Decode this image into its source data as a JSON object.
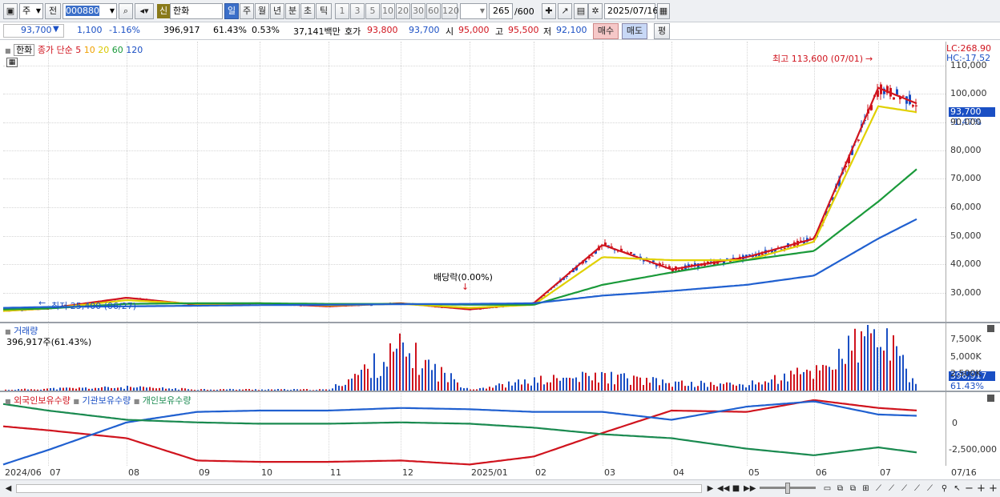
{
  "toolbar": {
    "type_select": "주",
    "prev_label": "전",
    "code": "000880",
    "badge": "신",
    "name": "한화",
    "periods": [
      "일",
      "주",
      "월",
      "년",
      "분",
      "초",
      "틱"
    ],
    "active_period": "일",
    "intervals": [
      "1",
      "3",
      "5",
      "10",
      "20",
      "30",
      "60",
      "120"
    ],
    "count_value": "265",
    "count_max": "/600",
    "date": "2025/07/16"
  },
  "quote": {
    "price": "93,700",
    "arrow": "▼",
    "change": "1,100",
    "change_pct": "-1.16%",
    "volume": "396,917",
    "vol_ratio": "61.43%",
    "turnover": "0.53%",
    "amount": "37,141백만",
    "hoga_label": "호가",
    "ask": "93,800",
    "bid": "93,700",
    "open_label": "시",
    "open": "95,000",
    "high_label": "고",
    "high": "95,500",
    "low_label": "저",
    "low": "92,100",
    "buy_label": "매수",
    "sell_label": "매도",
    "eval_label": "평"
  },
  "chart_legend": {
    "stock": "한화",
    "ma_title": "종가 단순",
    "ma_periods": [
      "5",
      "10",
      "20",
      "60",
      "120"
    ],
    "ma_colors": [
      "#d0141e",
      "#f0a000",
      "#e0d000",
      "#1a9a3a",
      "#2060d0"
    ]
  },
  "price_axis": {
    "lc": "LC:268.90",
    "hc": "HC:-17.52",
    "ticks": [
      "110,000",
      "100,000",
      "90,000",
      "80,000",
      "70,000",
      "60,000",
      "50,000",
      "40,000",
      "30,000"
    ],
    "current_tag": "93,700",
    "current_pct": "-1.47%"
  },
  "annotations": {
    "high": "최고 113,600 (07/01)",
    "low": "최저 25,400 (06/27)",
    "dividend": "배당락(0.00%)"
  },
  "volume_panel": {
    "title": "거래량",
    "summary": "396,917주(61.43%)",
    "ticks": [
      "7,500K",
      "5,000K",
      "2,500K"
    ],
    "current_tag": "396,917",
    "current_pct": "61.43%"
  },
  "holding_panel": {
    "series": [
      "외국인보유수량",
      "기관보유수량",
      "개인보유수량"
    ],
    "colors": [
      "#d0141e",
      "#2060d0",
      "#1a8a50"
    ],
    "ticks": [
      "0",
      "-2,500,000"
    ]
  },
  "x_axis": {
    "labels": [
      "2024/06",
      "07",
      "08",
      "09",
      "10",
      "11",
      "12",
      "2025/01",
      "02",
      "03",
      "04",
      "05",
      "06",
      "07"
    ],
    "end_label": "07/16"
  },
  "chart_data": {
    "type": "line",
    "title": "",
    "x": [
      "2024/06",
      "07",
      "08",
      "09",
      "10",
      "11",
      "12",
      "2025/01",
      "02",
      "03",
      "04",
      "05",
      "06",
      "07",
      "07/16"
    ],
    "series": [
      {
        "name": "5",
        "values": [
          26500,
          27300,
          30800,
          28500,
          29000,
          28000,
          29000,
          27000,
          29000,
          48000,
          40000,
          44000,
          50000,
          99000,
          93700
        ]
      },
      {
        "name": "20",
        "values": [
          26500,
          27300,
          30000,
          28800,
          29000,
          28300,
          28800,
          27500,
          28500,
          44000,
          43000,
          43000,
          49000,
          93000,
          91000
        ]
      },
      {
        "name": "60",
        "values": [
          27000,
          27300,
          28800,
          29000,
          29000,
          28800,
          28800,
          28500,
          28500,
          35000,
          39000,
          43000,
          46000,
          62000,
          73000
        ]
      },
      {
        "name": "120",
        "values": [
          27500,
          27800,
          28000,
          28200,
          28400,
          28500,
          28700,
          28800,
          29000,
          31500,
          33000,
          35000,
          38000,
          50000,
          56600
        ]
      }
    ],
    "ylim": [
      23000,
      114000
    ],
    "volume_values": [
      120000,
      300000,
      500000,
      200000,
      180000,
      150000,
      6200000,
      200000,
      1500000,
      2200000,
      1100000,
      900000,
      3000000,
      8800000,
      396917
    ],
    "holding_series": [
      {
        "name": "외국인보유수량",
        "values": [
          -700000,
          -1000000,
          -1600000,
          -3300000,
          -3400000,
          -3400000,
          -3300000,
          -3600000,
          -3000000,
          -1200000,
          500000,
          400000,
          1300000,
          700000,
          500000
        ]
      },
      {
        "name": "기관보유수량",
        "values": [
          -3600000,
          -2500000,
          -400000,
          400000,
          500000,
          500000,
          700000,
          600000,
          400000,
          400000,
          -200000,
          800000,
          1200000,
          200000,
          100000
        ]
      },
      {
        "name": "개인보유수량",
        "values": [
          1000000,
          500000,
          -200000,
          -400000,
          -500000,
          -500000,
          -400000,
          -500000,
          -800000,
          -1300000,
          -1600000,
          -2400000,
          -2900000,
          -2300000,
          -2700000
        ]
      }
    ],
    "holding_ylim": [
      -3700000,
      1900000
    ]
  }
}
